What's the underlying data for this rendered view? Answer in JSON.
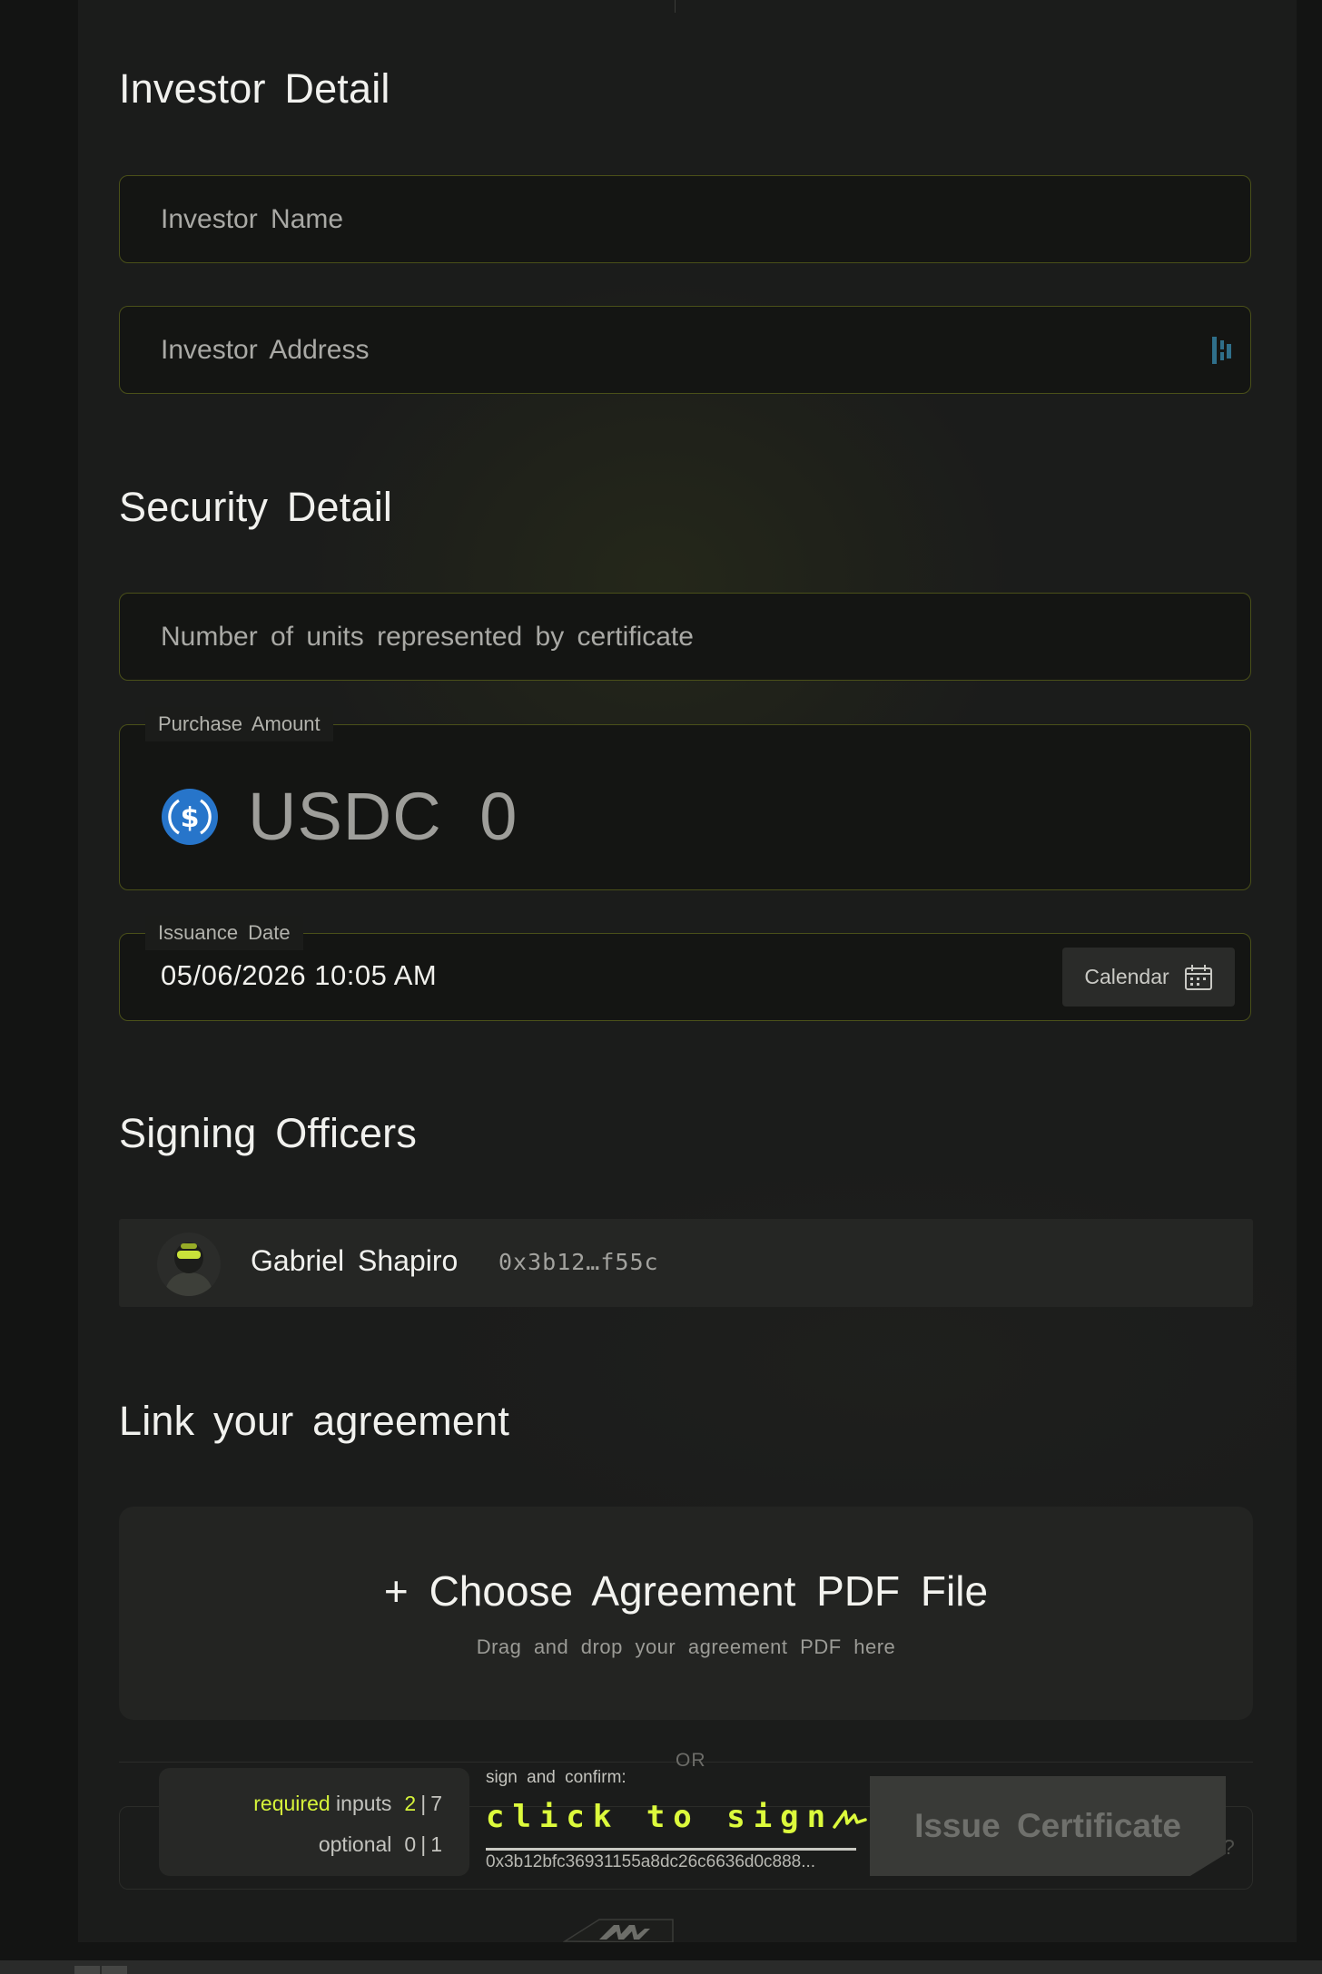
{
  "investor": {
    "title": "Investor Detail",
    "name_placeholder": "Investor Name",
    "name_value": "",
    "address_placeholder": "Investor Address",
    "address_value": ""
  },
  "security": {
    "title": "Security Detail",
    "units_placeholder": "Number of units represented by certificate",
    "units_value": "",
    "purchase_label": "Purchase Amount",
    "currency": "USDC",
    "amount": "0",
    "issuance_label": "Issuance Date",
    "issuance_value": "05/06/2026 10:05 AM",
    "calendar_label": "Calendar"
  },
  "officers": {
    "title": "Signing Officers",
    "items": [
      {
        "name": "Gabriel Shapiro",
        "address": "0x3b12…f55c"
      }
    ]
  },
  "agreement": {
    "title": "Link your agreement",
    "choose_label": "+ Choose Agreement PDF File",
    "drop_hint": "Drag and drop your agreement PDF here",
    "or_label": "OR"
  },
  "footer": {
    "required_key": "required",
    "inputs_word": "inputs",
    "required_filled": "2",
    "required_total": "7",
    "optional_key": "optional",
    "optional_filled": "0",
    "optional_total": "1",
    "separator": "|",
    "sign_caption": "sign and confirm:",
    "sign_action": "click to sign",
    "signer_address": "0x3b12bfc36931155a8dc26c6636d0c888...",
    "issue_label": "Issue Certificate",
    "help": "?"
  },
  "colors": {
    "accent": "#d6f43a",
    "field_border": "#4a5019",
    "usdc_blue": "#2775ca"
  },
  "icons": {
    "address_book": "address-book-icon",
    "usdc": "usdc-coin-icon",
    "calendar": "calendar-icon",
    "signature": "signature-icon",
    "logo": "brand-logo-icon"
  }
}
